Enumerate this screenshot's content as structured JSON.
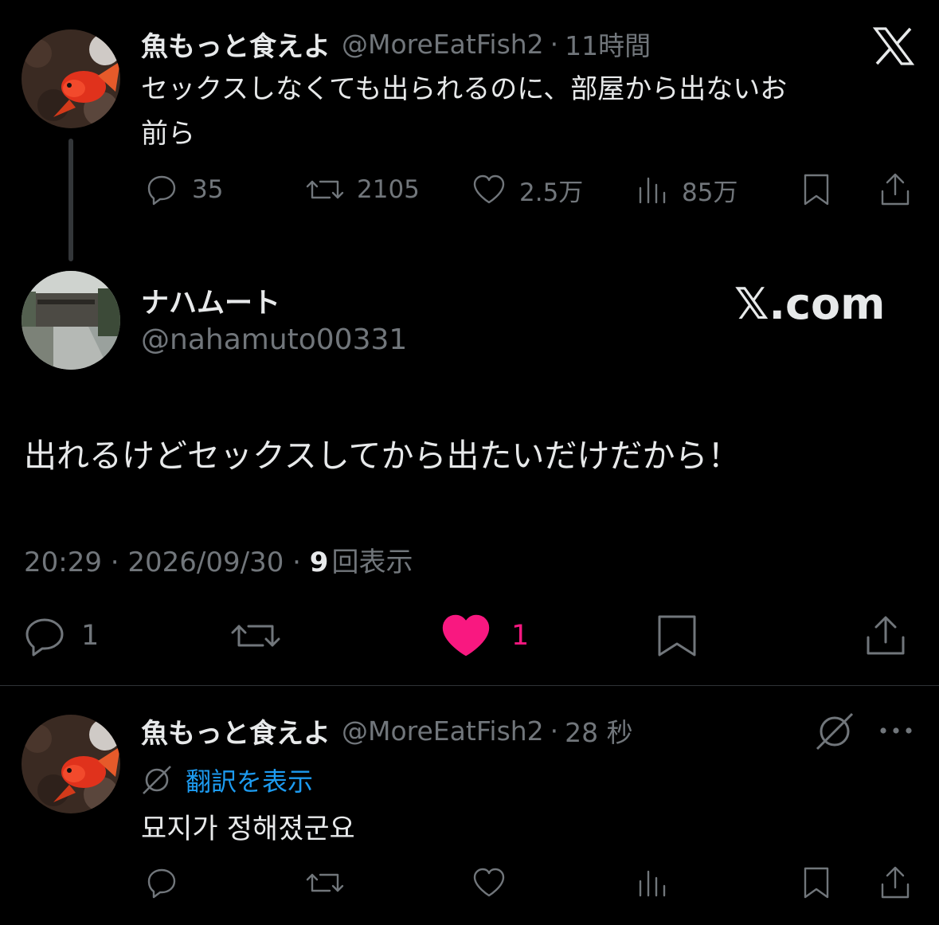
{
  "top_tweet": {
    "display_name": "魚もっと食えよ",
    "handle": "@MoreEatFish2",
    "time": "11時間",
    "text_line1": "セックスしなくても出られるのに、部屋から出ないお",
    "text_line2": "前ら",
    "replies": "35",
    "retweets": "2105",
    "likes": "2.5万",
    "views": "85万",
    "logo_icon": "x-logo-icon"
  },
  "main_tweet": {
    "display_name": "ナハムート",
    "handle": "@nahamuto00331",
    "watermark": "𝕏.com",
    "text": "出れるけどセックスしてから出たいだけだから！",
    "timestamp": "20:29 · 2026/09/30 · ",
    "view_count": "9",
    "view_label": "回表示",
    "replies": "1",
    "likes": "1",
    "like_color": "#f91880"
  },
  "reply_tweet": {
    "display_name": "魚もっと食えよ",
    "handle": "@MoreEatFish2",
    "time": "28 秒",
    "translate_label": "翻訳を表示",
    "text": "묘지가 정해졌군요",
    "link_color": "#1d9bf0"
  }
}
